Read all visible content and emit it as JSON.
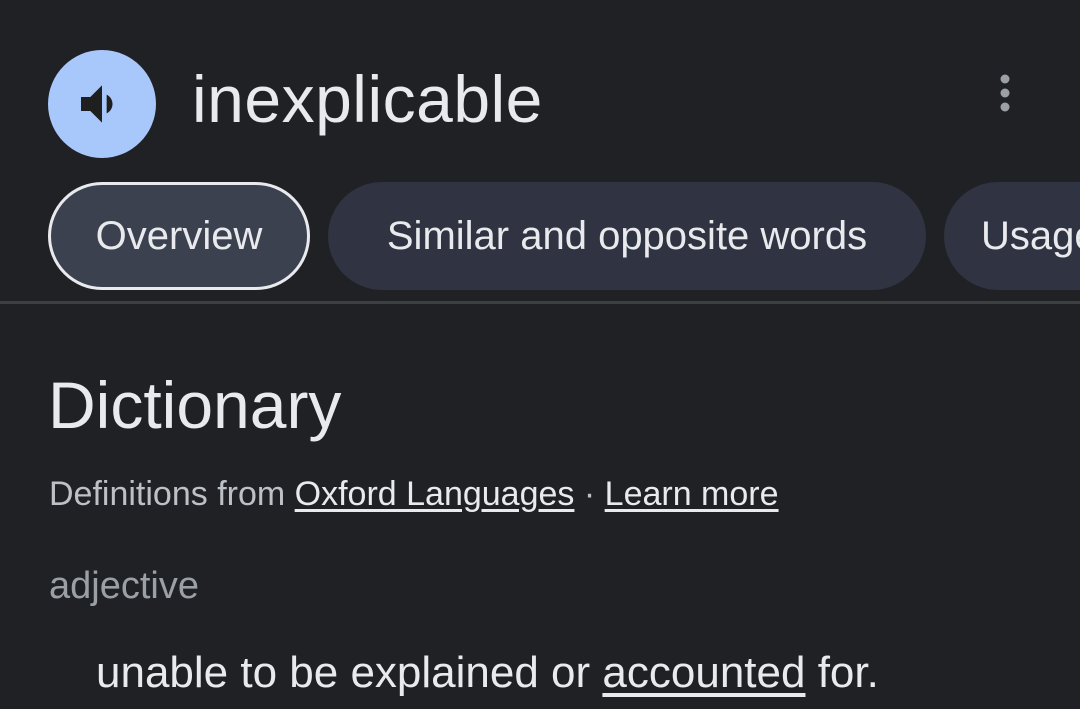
{
  "header": {
    "word": "inexplicable",
    "speaker_icon": "volume-up-icon",
    "more_icon": "more-vert-icon"
  },
  "tabs": [
    {
      "label": "Overview",
      "active": true
    },
    {
      "label": "Similar and opposite words",
      "active": false
    },
    {
      "label": "Usage",
      "active": false
    }
  ],
  "dictionary": {
    "title": "Dictionary",
    "source_prefix": "Definitions from",
    "source_link": "Oxford Languages",
    "separator": "·",
    "learn_more": "Learn more",
    "part_of_speech": "adjective",
    "definition_before": "unable to be explained or",
    "definition_link": "accounted",
    "definition_after": "for."
  },
  "colors": {
    "background": "#202124",
    "speaker_accent": "#a8c7fa",
    "tab_bg": "#303341",
    "text": "#e8eaed",
    "muted_text": "#9aa0a6"
  }
}
